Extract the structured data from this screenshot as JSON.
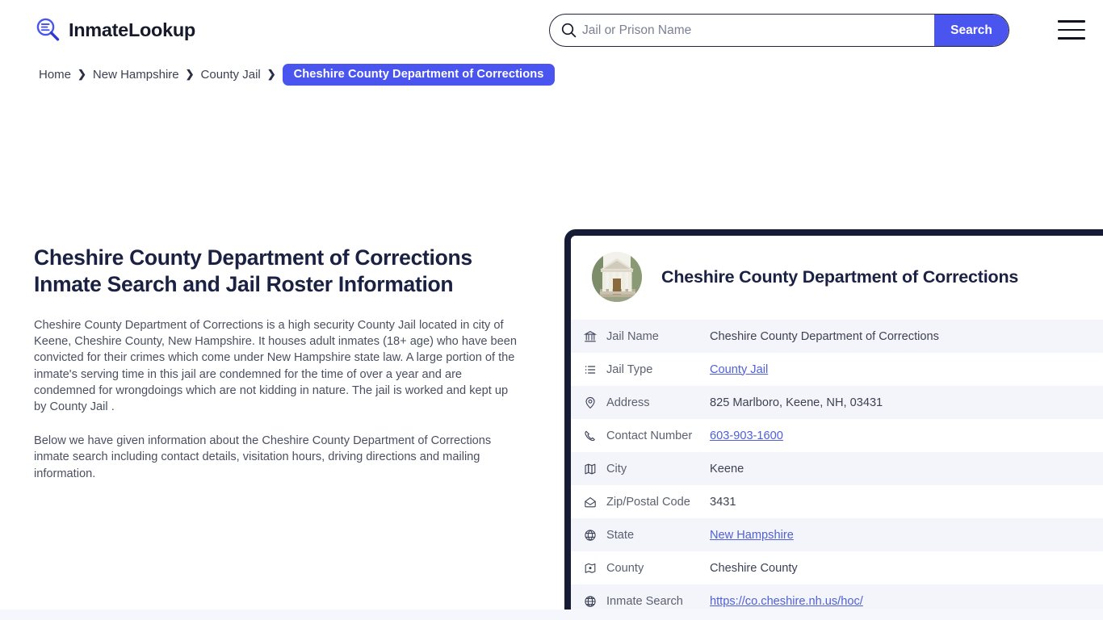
{
  "header": {
    "brand_name": "InmateLookup",
    "brand_icon": "magnifier-list-logo-icon",
    "search": {
      "placeholder": "Jail or Prison Name",
      "value": "",
      "icon": "search-icon",
      "button_label": "Search"
    },
    "menu_icon": "hamburger-menu-icon"
  },
  "breadcrumb": {
    "items": [
      {
        "label": "Home",
        "current": false
      },
      {
        "label": "New Hampshire",
        "current": false
      },
      {
        "label": "County Jail",
        "current": false
      },
      {
        "label": "Cheshire County Department of Corrections",
        "current": true
      }
    ],
    "separator": "❯"
  },
  "main": {
    "title": "Cheshire County Department of Corrections Inmate Search and Jail Roster Information",
    "paragraph_1": "Cheshire County Department of Corrections is a high security County Jail located in city of Keene, Cheshire County, New Hampshire. It houses adult inmates (18+ age) who have been convicted for their crimes which come under New Hampshire state law. A large portion of the inmate's serving time in this jail are condemned for the time of over a year and are condemned for wrongdoings which are not kidding in nature. The jail is worked and kept up by County Jail .",
    "paragraph_2": "Below we have given information about the Cheshire County Department of Corrections inmate search including contact details, visitation hours, driving directions and mailing information."
  },
  "card": {
    "title": "Cheshire County Department of Corrections",
    "thumbnail_icon": "courthouse-building-photo",
    "rows": [
      {
        "icon": "bank-icon",
        "label": "Jail Name",
        "value": "Cheshire County Department of Corrections",
        "link": false
      },
      {
        "icon": "list-icon",
        "label": "Jail Type",
        "value": "County Jail",
        "link": true
      },
      {
        "icon": "location-pin-icon",
        "label": "Address",
        "value": "825 Marlboro, Keene, NH, 03431",
        "link": false
      },
      {
        "icon": "phone-icon",
        "label": "Contact Number",
        "value": "603-903-1600",
        "link": true
      },
      {
        "icon": "map-icon",
        "label": "City",
        "value": "Keene",
        "link": false
      },
      {
        "icon": "envelope-icon",
        "label": "Zip/Postal Code",
        "value": "3431",
        "link": false
      },
      {
        "icon": "globe-icon",
        "label": "State",
        "value": "New Hampshire",
        "link": true
      },
      {
        "icon": "county-map-icon",
        "label": "County",
        "value": "Cheshire County",
        "link": false
      },
      {
        "icon": "web-globe-icon",
        "label": "Inmate Search",
        "value": "https://co.cheshire.nh.us/hoc/",
        "link": true
      }
    ]
  },
  "colors": {
    "accent_blue": "#4a55f0",
    "link_blue": "#4f5fd7",
    "card_border_navy": "#151c33",
    "heading_navy": "#1b2142",
    "row_alt_bg": "#f4f5fb",
    "footer_band": "#f6f6fd"
  }
}
